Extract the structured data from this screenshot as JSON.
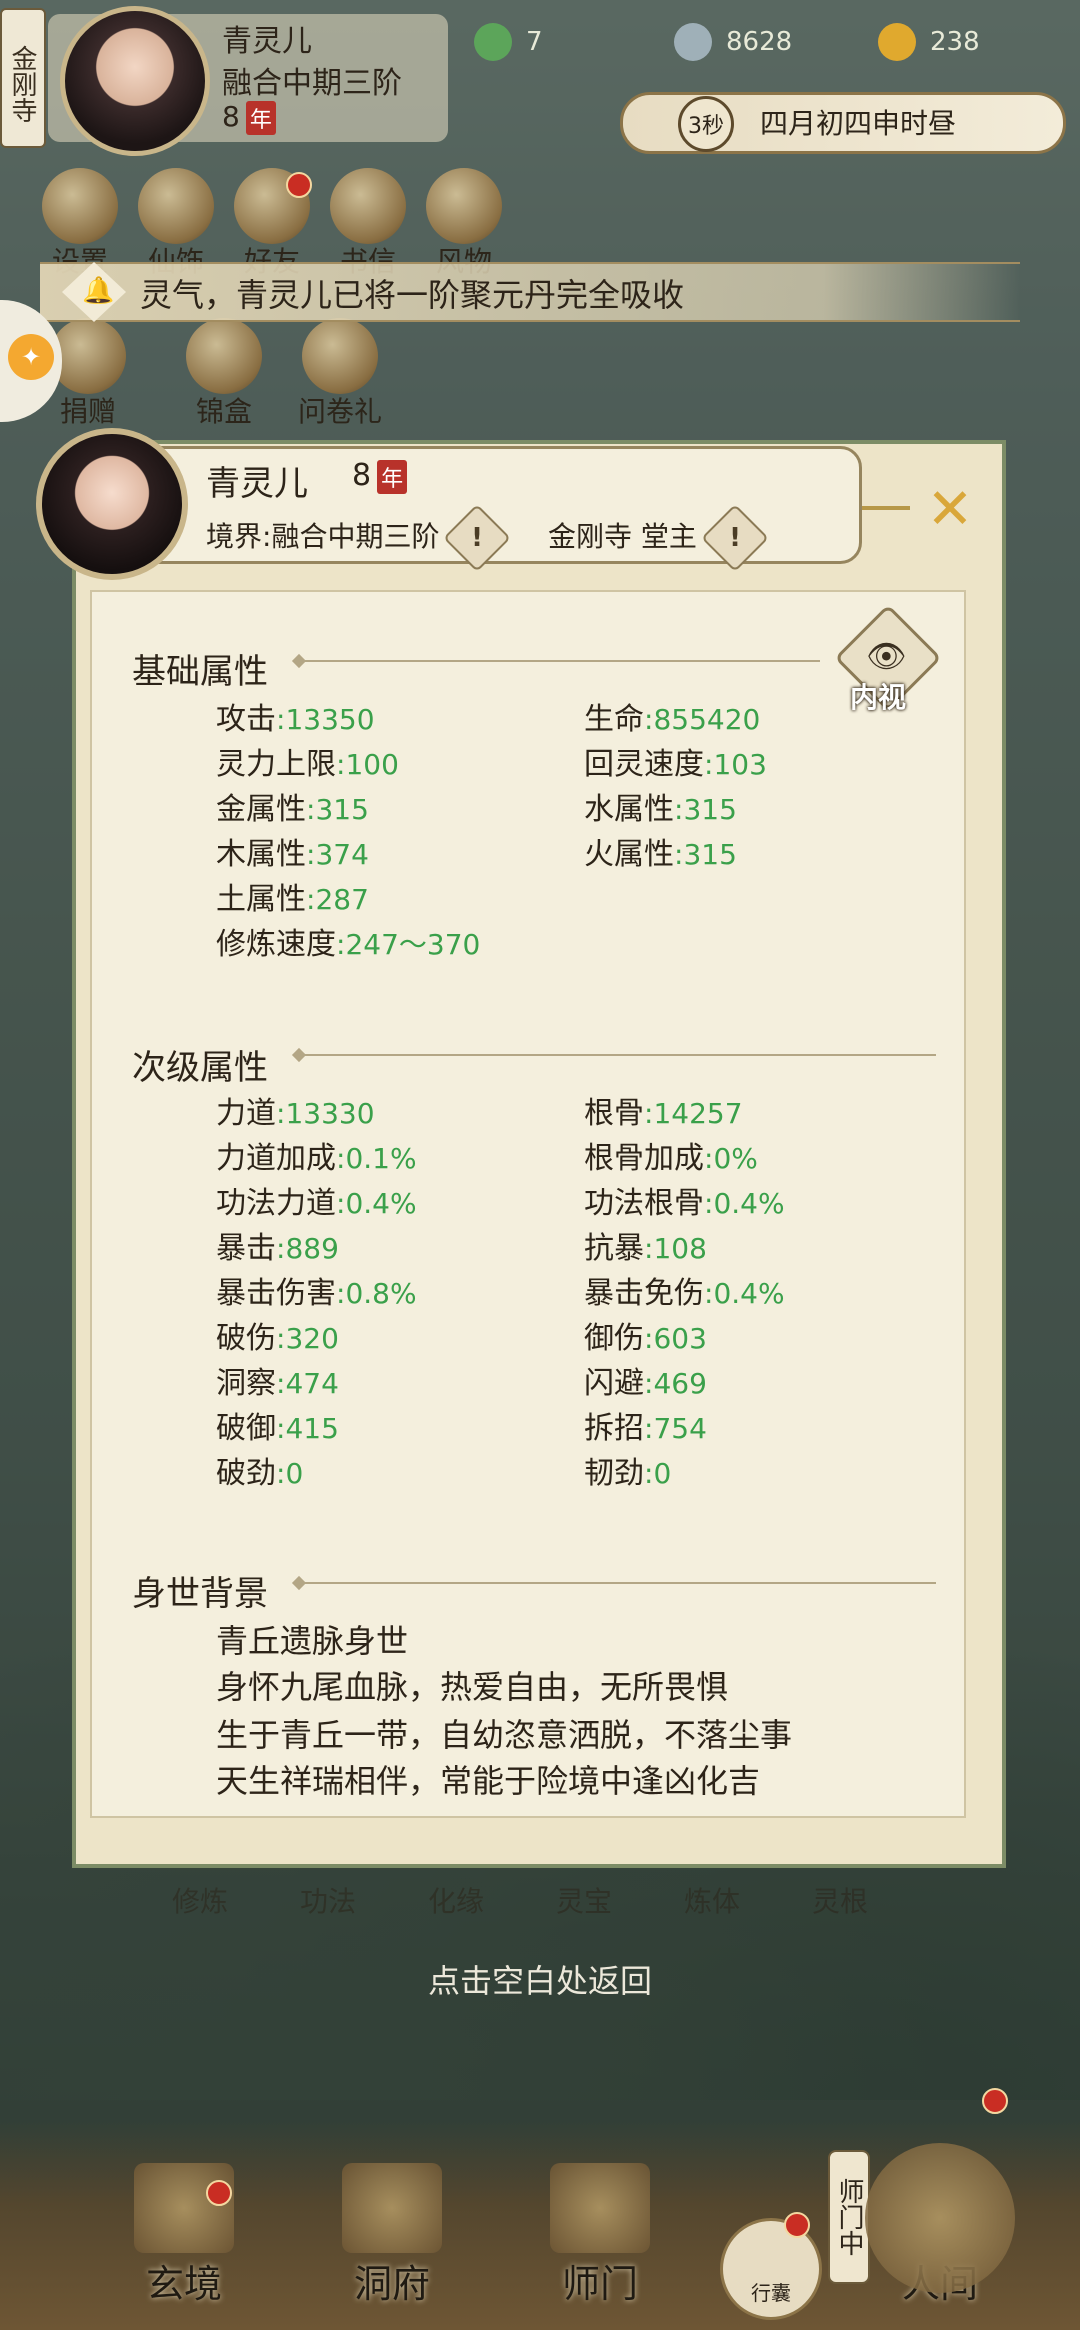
{
  "hud": {
    "sect_label": "金刚寺",
    "player_name": "青灵儿",
    "realm": "融合中期三阶",
    "age": "8",
    "age_unit": "年",
    "jade": "7",
    "coins": "8628",
    "gold": "238",
    "time_seconds": "3秒",
    "time_text": "四月初四申时昼"
  },
  "top_icons": [
    "设置",
    "仙饰",
    "好友",
    "书信",
    "风物"
  ],
  "second_icons": [
    "捐赠",
    "锦盒",
    "问卷礼"
  ],
  "notice": {
    "text": "灵气，青灵儿已将一阶聚元丹完全吸收"
  },
  "panel": {
    "name": "青灵儿",
    "age": "8",
    "age_unit": "年",
    "realm_label": "境界:",
    "realm_value": "融合中期三阶",
    "sect_value": "金刚寺 堂主",
    "view_label": "内视",
    "sections": {
      "basic": {
        "title": "基础属性",
        "attrs": [
          {
            "label": "攻击",
            "value": "13350"
          },
          {
            "label": "生命",
            "value": "855420"
          },
          {
            "label": "灵力上限",
            "value": "100"
          },
          {
            "label": "回灵速度",
            "value": "103"
          },
          {
            "label": "金属性",
            "value": "315"
          },
          {
            "label": "水属性",
            "value": "315"
          },
          {
            "label": "木属性",
            "value": "374"
          },
          {
            "label": "火属性",
            "value": "315"
          },
          {
            "label": "土属性",
            "value": "287"
          },
          {
            "label": "修炼速度",
            "value": "247～370"
          }
        ]
      },
      "secondary": {
        "title": "次级属性",
        "attrs": [
          {
            "label": "力道",
            "value": "13330"
          },
          {
            "label": "根骨",
            "value": "14257"
          },
          {
            "label": "力道加成",
            "value": "0.1%"
          },
          {
            "label": "根骨加成",
            "value": "0%"
          },
          {
            "label": "功法力道",
            "value": "0.4%"
          },
          {
            "label": "功法根骨",
            "value": "0.4%"
          },
          {
            "label": "暴击",
            "value": "889"
          },
          {
            "label": "抗暴",
            "value": "108"
          },
          {
            "label": "暴击伤害",
            "value": "0.8%"
          },
          {
            "label": "暴击免伤",
            "value": "0.4%"
          },
          {
            "label": "破伤",
            "value": "320"
          },
          {
            "label": "御伤",
            "value": "603"
          },
          {
            "label": "洞察",
            "value": "474"
          },
          {
            "label": "闪避",
            "value": "469"
          },
          {
            "label": "破御",
            "value": "415"
          },
          {
            "label": "拆招",
            "value": "754"
          },
          {
            "label": "破劲",
            "value": "0"
          },
          {
            "label": "韧劲",
            "value": "0"
          }
        ]
      },
      "background": {
        "title": "身世背景",
        "lines": [
          "青丘遗脉身世",
          "身怀九尾血脉，热爱自由，无所畏惧",
          "生于青丘一带，自幼恣意洒脱，不落尘事",
          "天生祥瑞相伴，常能于险境中逢凶化吉"
        ]
      }
    }
  },
  "lower_icons": [
    "修炼",
    "功法",
    "化缘",
    "灵宝",
    "炼体",
    "灵根"
  ],
  "tap_back": "点击空白处返回",
  "bottom_nav": {
    "xuanjing": "玄境",
    "dongfu": "洞府",
    "shimen": "师门",
    "bag": "行囊",
    "renjian": "人间",
    "shimen_tag": "师门中"
  },
  "colors": {
    "value_green": "#3aa04a",
    "panel_bg": "#ede4c8",
    "accent_gold": "#d9a73a",
    "badge_red": "#c92d23"
  }
}
